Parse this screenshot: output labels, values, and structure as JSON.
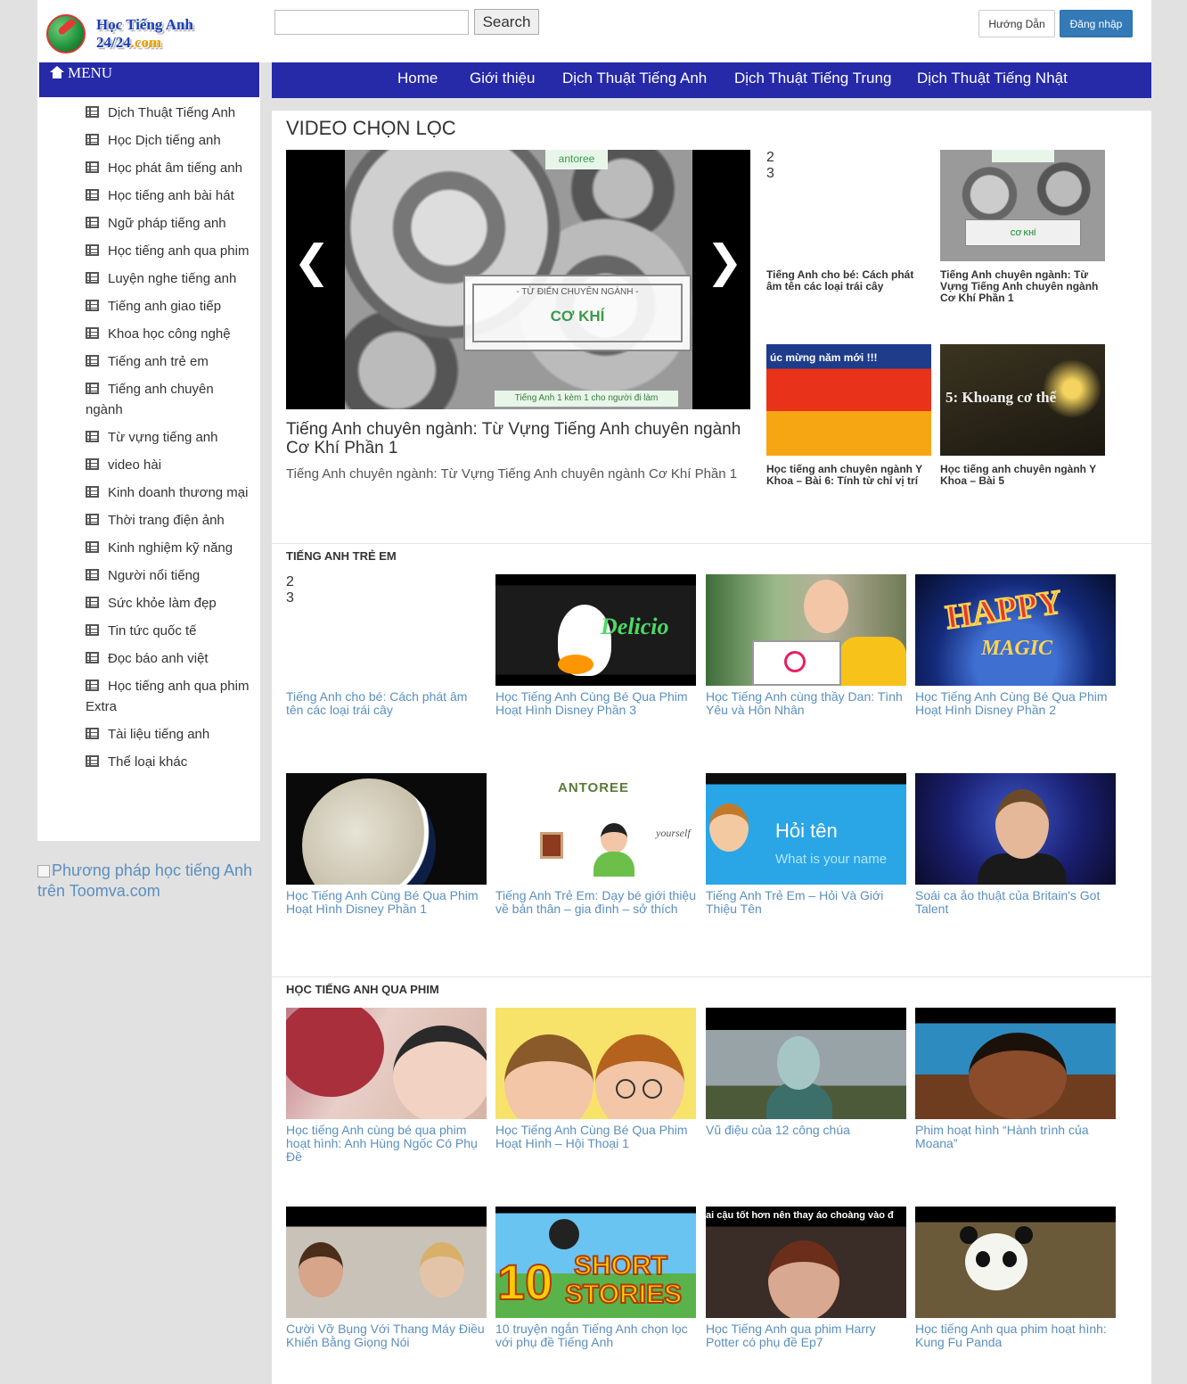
{
  "header": {
    "logo_line1": "Học Tiếng Anh",
    "logo_line2_a": "24/24",
    "logo_line2_b": ".com",
    "search_placeholder": "",
    "search_button": "Search",
    "guide_button": "Hướng Dẫn",
    "login_button": "Đăng nhập"
  },
  "colors": {
    "nav_bg": "#2629a8",
    "link": "#5a8fc0",
    "login_bg": "#337ab7",
    "page_bg": "#e1e1e1"
  },
  "sidebar": {
    "menu_title": "MENU",
    "items": [
      "Dịch Thuật Tiếng Anh",
      "Học Dịch tiếng anh",
      "Học phát âm tiếng anh",
      "Học tiếng anh bài hát",
      "Ngữ pháp tiếng anh",
      "Học tiếng anh qua phim",
      "Luyện nghe tiếng anh",
      "Tiếng anh giao tiếp",
      "Khoa học công nghệ",
      "Tiếng anh trẻ em",
      "Tiếng anh chuyên ngành",
      "Từ vựng tiếng anh",
      "video hài",
      "Kinh doanh thương mại",
      "Thời trang điện ảnh",
      "Kinh nghiệm kỹ năng",
      "Người nổi tiếng",
      "Sức khỏe làm đẹp",
      "Tin tức quốc tế",
      "Đọc báo anh việt",
      "Học tiếng anh qua phim Extra",
      "Tài liệu tiếng anh",
      "Thể loại khác"
    ],
    "promo_alt": "Phương pháp học tiếng Anh trên Toomva.com"
  },
  "nav": {
    "items": [
      "Home",
      "Giới thiệu",
      "Dịch Thuật Tiếng Anh",
      "Dịch Thuật Tiếng Trung",
      "Dịch Thuật Tiếng Nhật"
    ]
  },
  "featured": {
    "section_title": "VIDEO CHỌN LỌC",
    "slide": {
      "brand": "antoree",
      "panel_small": "- TỪ ĐIỂN CHUYÊN NGÀNH -",
      "panel_big": "CƠ KHÍ",
      "footer": "Tiếng Anh 1 kèm 1 cho người đi làm",
      "prev": "❮",
      "next": "❯"
    },
    "heading": "Tiếng Anh chuyên ngành: Từ Vựng Tiếng Anh chuyên ngành Cơ Khí Phần 1",
    "description": "Tiếng Anh chuyên ngành: Từ Vựng Tiếng Anh chuyên ngành Cơ Khí Phần 1",
    "side_videos": [
      {
        "caption": "Tiếng Anh cho bé: Cách phát âm tên các loại trái cây",
        "thumb": "numbers"
      },
      {
        "caption": "Tiếng Anh chuyên ngành: Từ Vựng Tiếng Anh chuyên ngành Cơ Khí Phần 1",
        "thumb": "gears",
        "thumb_text": "CƠ KHÍ"
      },
      {
        "caption": "Học tiếng anh chuyên ngành Y Khoa – Bài 6: Tính từ chỉ vị trí",
        "thumb": "newyear",
        "thumb_text": "úc mừng năm mới !!!"
      },
      {
        "caption": "Học tiếng anh chuyên ngành Y Khoa – Bài 5",
        "thumb": "fireworks",
        "thumb_text": "5: Khoang cơ thể"
      }
    ]
  },
  "kids_section": {
    "title": "TIẾNG ANH TRẺ EM",
    "videos": [
      {
        "caption": "Tiếng Anh cho bé: Cách phát âm tên các loại trái cây",
        "thumb": "numbers"
      },
      {
        "caption": "Học Tiếng Anh Cùng Bé Qua Phim Hoạt Hình Disney Phần 3",
        "thumb": "duck",
        "thumb_text": "Delicio"
      },
      {
        "caption": "Học Tiếng Anh cùng thầy Dan: Tình Yêu và Hôn Nhân",
        "thumb": "teacher"
      },
      {
        "caption": "Học Tiếng Anh Cùng Bé Qua Phim Hoạt Hình Disney Phần 2",
        "thumb": "happy",
        "thumb_text": "HAPPY",
        "thumb_text2": "MAGIC"
      },
      {
        "caption": "Học Tiếng Anh Cùng Bé Qua Phim Hoạt Hình Disney Phần 1",
        "thumb": "toon1"
      },
      {
        "caption": "Tiếng Anh Trẻ Em: Dạy bé giới thiệu về bản thân – gia đình – sở thích",
        "thumb": "antoree",
        "thumb_text": "ANTOREE",
        "thumb_text2": "yourself"
      },
      {
        "caption": "Tiếng Anh Trẻ Em – Hỏi Và Giới Thiệu Tên",
        "thumb": "blue",
        "thumb_text": "Hỏi tên",
        "thumb_text2": "What is your name"
      },
      {
        "caption": "Soái ca ảo thuật của Britain's Got Talent",
        "thumb": "stage"
      }
    ]
  },
  "movies_section": {
    "title": "HỌC TIẾNG ANH QUA PHIM",
    "videos": [
      {
        "caption": "Học tiếng Anh cùng bé qua phim hoạt hình: Anh Hùng Ngốc Có Phụ Đề",
        "thumb": "kiss"
      },
      {
        "caption": "Học Tiếng Anh Cùng Bé Qua Phim Hoạt Hình – Hội Thoại 1",
        "thumb": "kids"
      },
      {
        "caption": "Vũ điệu của 12 công chúa",
        "thumb": "queen"
      },
      {
        "caption": "Phim hoạt hình “Hành trình của Moana”",
        "thumb": "moana"
      },
      {
        "caption": "Cười Vỡ Bụng Với Thang Máy Điều Khiển Bằng Giọng Nói",
        "thumb": "elevator"
      },
      {
        "caption": "10 truyện ngắn Tiếng Anh chọn lọc với phụ đề Tiếng Anh",
        "thumb": "short",
        "thumb_text": "10",
        "thumb_text2": "SHORT",
        "thumb_text3": "STORIES"
      },
      {
        "caption": "Học Tiếng Anh qua phim Harry Potter có phụ đề Ep7",
        "thumb": "potter",
        "thumb_text": "ai cậu tốt hơn nên thay áo choàng vào đ"
      },
      {
        "caption": "Học tiếng Anh qua phim hoạt hình: Kung Fu Panda",
        "thumb": "panda"
      }
    ]
  }
}
